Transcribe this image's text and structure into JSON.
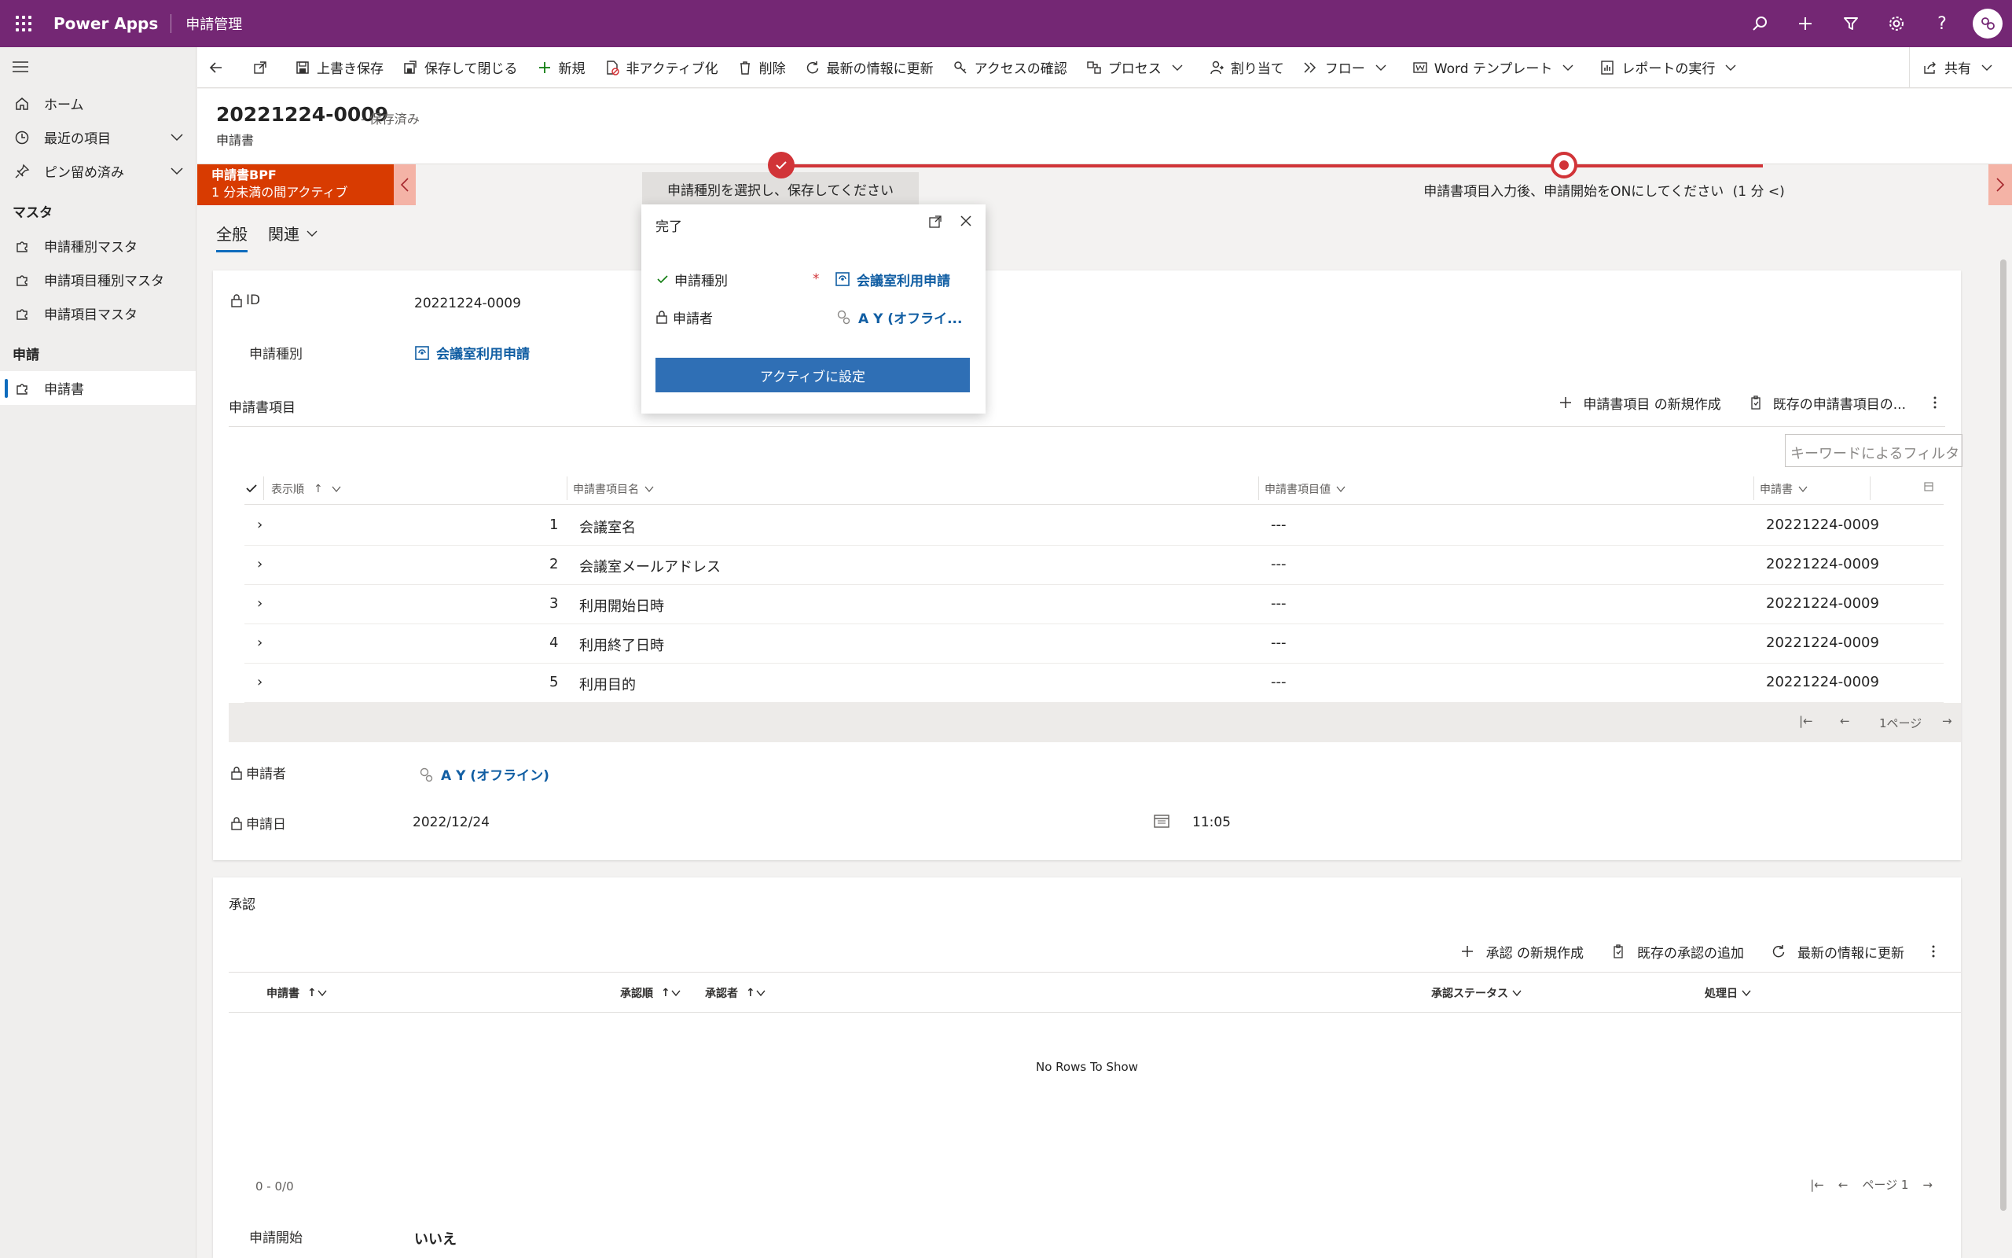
{
  "topbar": {
    "app_name": "Power Apps",
    "env_name": "申請管理",
    "icons": [
      "search-icon",
      "plus-icon",
      "filter-icon",
      "gear-icon",
      "help-icon",
      "avatar"
    ],
    "color": "#742774"
  },
  "sidebar": {
    "items": [
      {
        "label": "ホーム",
        "icon": "home-icon"
      },
      {
        "label": "最近の項目",
        "icon": "clock-icon"
      },
      {
        "label": "ピン留め済み",
        "icon": "pin-icon"
      }
    ],
    "sections": [
      {
        "title": "マスタ",
        "items": [
          "申請種別マスタ",
          "申請項目種別マスタ",
          "申請項目マスタ"
        ]
      },
      {
        "title": "申請",
        "items": [
          "申請書"
        ]
      }
    ],
    "active": "申請書"
  },
  "commands": {
    "save": "上書き保存",
    "save_close": "保存して閉じる",
    "new": "新規",
    "deactivate": "非アクティブ化",
    "delete": "削除",
    "refresh": "最新の情報に更新",
    "check_access": "アクセスの確認",
    "process": "プロセス",
    "assign": "割り当て",
    "flow": "フロー",
    "word_template": "Word テンプレート",
    "run_report": "レポートの実行",
    "share": "共有"
  },
  "header": {
    "title": "20221224-0009",
    "status": "- 保存済み",
    "entity": "申請書"
  },
  "bpf": {
    "name": "申請書BPF",
    "active_time": "1 分未満の間アクティブ",
    "stage1": "申請種別を選択し、保存してください",
    "stage2": "申請書項目入力後、申請開始をONにしてください",
    "stage2_time": "(1 分 <)",
    "accent": "#d13438"
  },
  "flyout": {
    "title": "完了",
    "field1_label": "申請種別",
    "field1_required": "*",
    "field1_value": "会議室利用申請",
    "field2_label": "申請者",
    "field2_value": "A Y (オフライ...",
    "button": "アクティブに設定"
  },
  "tabs": {
    "general": "全般",
    "related": "関連"
  },
  "form": {
    "id_label": "ID",
    "id_value": "20221224-0009",
    "type_label": "申請種別",
    "type_value": "会議室利用申請",
    "applicant_label": "申請者",
    "applicant_value": "A Y (オフライン)",
    "date_label": "申請日",
    "date_value": "2022/12/24",
    "time_value": "11:05"
  },
  "items_grid": {
    "title": "申請書項目",
    "new_label": "申請書項目 の新規作成",
    "add_existing_label": "既存の申請書項目の...",
    "filter_placeholder": "キーワードによるフィルタ",
    "columns": [
      "表示順",
      "申請書項目名",
      "申請書項目値",
      "申請書"
    ],
    "rows": [
      {
        "order": "1",
        "name": "会議室名",
        "value": "---",
        "doc": "20221224-0009"
      },
      {
        "order": "2",
        "name": "会議室メールアドレス",
        "value": "---",
        "doc": "20221224-0009"
      },
      {
        "order": "3",
        "name": "利用開始日時",
        "value": "---",
        "doc": "20221224-0009"
      },
      {
        "order": "4",
        "name": "利用終了日時",
        "value": "---",
        "doc": "20221224-0009"
      },
      {
        "order": "5",
        "name": "利用目的",
        "value": "---",
        "doc": "20221224-0009"
      }
    ],
    "page_label": "1ページ"
  },
  "approval": {
    "title": "承認",
    "new_label": "承認 の新規作成",
    "add_existing_label": "既存の承認の追加",
    "refresh_label": "最新の情報に更新",
    "columns": [
      "申請書",
      "承認順",
      "承認者",
      "承認ステータス",
      "処理日"
    ],
    "empty": "No Rows To Show",
    "count": "0 - 0/0",
    "page_label": "ページ 1",
    "start_label": "申請開始",
    "start_value": "いいえ"
  }
}
